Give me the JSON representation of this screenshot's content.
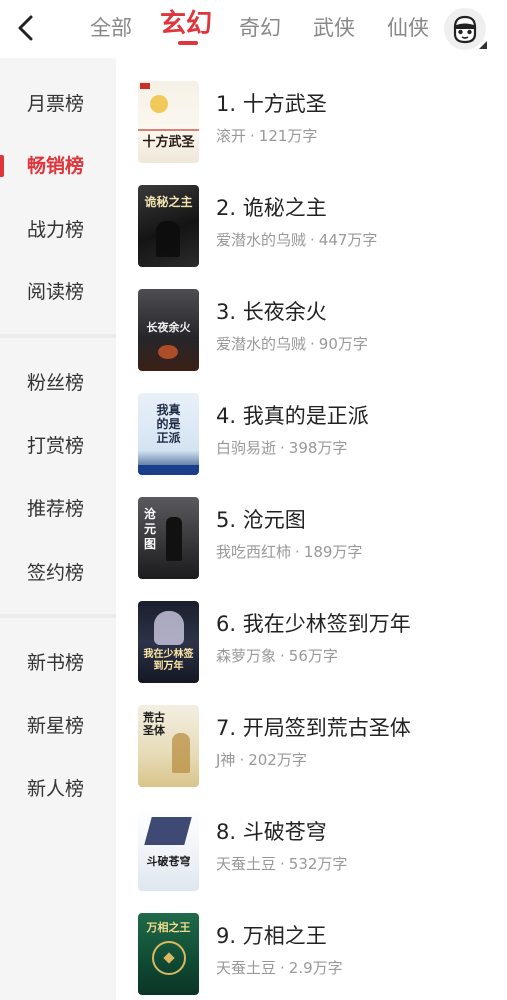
{
  "tabs": [
    {
      "label": "全部"
    },
    {
      "label": "玄幻"
    },
    {
      "label": "奇幻"
    },
    {
      "label": "武侠"
    },
    {
      "label": "仙侠"
    }
  ],
  "sidebar": {
    "items": [
      {
        "label": "月票榜"
      },
      {
        "label": "畅销榜"
      },
      {
        "label": "战力榜"
      },
      {
        "label": "阅读榜"
      },
      {
        "label": "粉丝榜"
      },
      {
        "label": "打赏榜"
      },
      {
        "label": "推荐榜"
      },
      {
        "label": "签约榜"
      },
      {
        "label": "新书榜"
      },
      {
        "label": "新星榜"
      },
      {
        "label": "新人榜"
      }
    ]
  },
  "books": [
    {
      "title": "1. 十方武圣",
      "author": "滚开",
      "words": "121万字",
      "cover_text": "十方武圣"
    },
    {
      "title": "2. 诡秘之主",
      "author": "爱潜水的乌贼",
      "words": "447万字",
      "cover_text": "诡秘之主"
    },
    {
      "title": "3. 长夜余火",
      "author": "爱潜水的乌贼",
      "words": "90万字",
      "cover_text": "长夜余火"
    },
    {
      "title": "4. 我真的是正派",
      "author": "白驹易逝",
      "words": "398万字",
      "cover_text": "我真的是正派"
    },
    {
      "title": "5. 沧元图",
      "author": "我吃西红柿",
      "words": "189万字",
      "cover_text": "沧元图"
    },
    {
      "title": "6. 我在少林签到万年",
      "author": "森萝万象",
      "words": "56万字",
      "cover_text": "我在少林签到万年"
    },
    {
      "title": "7. 开局签到荒古圣体",
      "author": "J神",
      "words": "202万字",
      "cover_text": "荒古圣体"
    },
    {
      "title": "8. 斗破苍穹",
      "author": "天蚕土豆",
      "words": "532万字",
      "cover_text": "斗破苍穹"
    },
    {
      "title": "9. 万相之王",
      "author": "天蚕土豆",
      "words": "2.9万字",
      "cover_text": "万相之王"
    }
  ],
  "meta_separator": "·",
  "colors": {
    "accent": "#e0353b",
    "sidebar_bg": "#f5f5f5",
    "meta_text": "#999999"
  }
}
